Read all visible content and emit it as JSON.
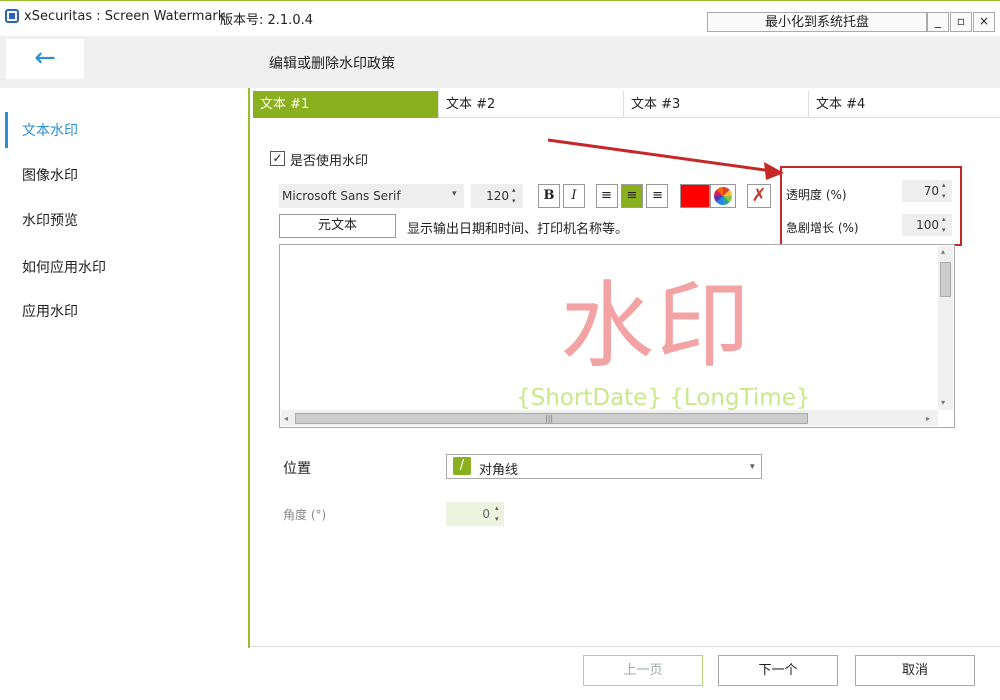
{
  "window": {
    "title": "xSecuritas : Screen Watermark",
    "version": "版本号: 2.1.0.4",
    "minimize_to_tray": "最小化到系统托盘",
    "min_glyph": "_",
    "max_glyph": "▫",
    "close_glyph": "×"
  },
  "header": {
    "back_glyph": "←",
    "page_title": "编辑或删除水印政策"
  },
  "sidebar": {
    "items": [
      {
        "label": "文本水印",
        "active": true
      },
      {
        "label": "图像水印"
      },
      {
        "label": "水印预览"
      },
      {
        "label": "如何应用水印"
      },
      {
        "label": "应用水印"
      }
    ]
  },
  "tabs": [
    {
      "label": "文本 #1",
      "active": true
    },
    {
      "label": "文本 #2"
    },
    {
      "label": "文本 #3"
    },
    {
      "label": "文本 #4"
    }
  ],
  "editor": {
    "use_watermark_label": "是否使用水印",
    "use_watermark_checked": true,
    "checkmark": "✓",
    "font_family": "Microsoft Sans Serif",
    "font_size": "120",
    "bold": "B",
    "italic": "I",
    "align_left": "≡",
    "align_center": "≡",
    "align_right": "≡",
    "text_color": "#ff0000",
    "clear_glyph": "✗",
    "metatext_button": "元文本",
    "metatext_desc": "显示输出日期和时间、打印机名称等。",
    "transparency_label": "透明度 (%)",
    "transparency_value": "70",
    "spike_label": "急剧增长 (%)",
    "spike_value": "100",
    "watermark_text": "水印",
    "watermark_subtext": "{ShortDate}  {LongTime}",
    "scroll_left": "◂",
    "scroll_right": "▸",
    "scroll_up": "▴",
    "scroll_down": "▾",
    "spin_up": "▴",
    "spin_down": "▾",
    "caret": "▾",
    "thumb_grip": "|||"
  },
  "position": {
    "label": "位置",
    "value": "对角线",
    "icon_glyph": "/"
  },
  "angle": {
    "label": "角度 (°)",
    "value": "0"
  },
  "footer": {
    "prev": "上一页",
    "next": "下一个",
    "cancel": "取消"
  },
  "colors": {
    "accent_green": "#8bb01f",
    "accent_blue": "#2a8fd6",
    "highlight_red": "#c62828",
    "watermark_pink": "#f3a3a3",
    "watermark_subtext_green": "#c9e88a"
  }
}
